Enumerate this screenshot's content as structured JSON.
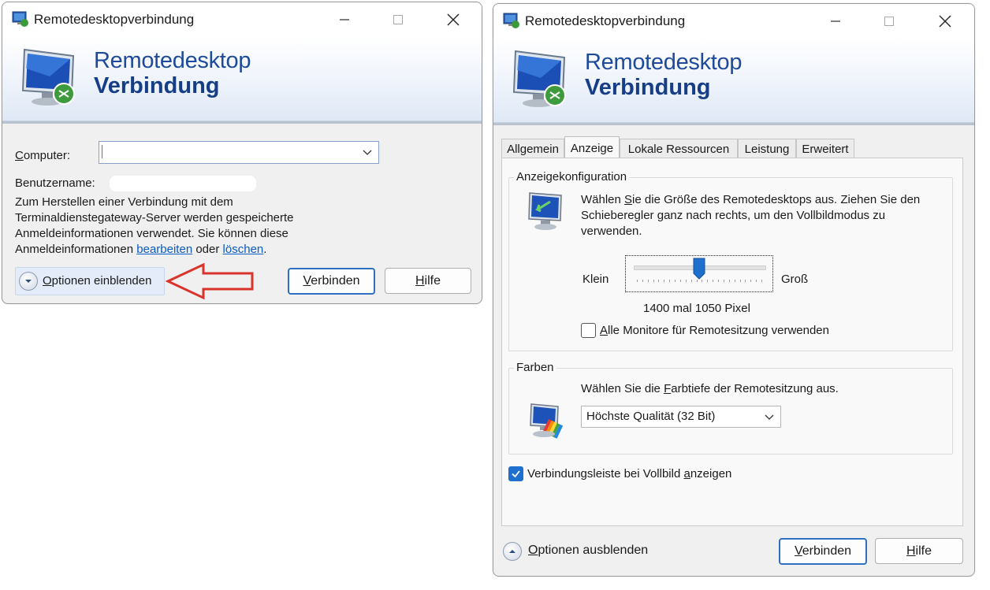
{
  "left": {
    "title": "Remotedesktopverbindung",
    "banner_line1": "Remotedesktop",
    "banner_line2": "Verbindung",
    "computer_label_u": "C",
    "computer_label_rest": "omputer:",
    "username_label": "Benutzername:",
    "info_text": "Zum Herstellen einer Verbindung mit dem Terminaldienstegateway-Server werden gespeicherte Anmeldeinformationen verwendet. Sie können diese Anmeldeinformationen",
    "link_edit": "bearbeiten",
    "word_or": "oder",
    "link_delete": "löschen",
    "period": ".",
    "options_u": "O",
    "options_rest": "ptionen einblenden",
    "connect_u": "V",
    "connect_rest": "erbinden",
    "help_u": "H",
    "help_rest": "ilfe"
  },
  "right": {
    "title": "Remotedesktopverbindung",
    "banner_line1": "Remotedesktop",
    "banner_line2": "Verbindung",
    "tabs": [
      "Allgemein",
      "Anzeige",
      "Lokale Ressourcen",
      "Leistung",
      "Erweitert"
    ],
    "active_tab": "Anzeige",
    "group1_title": "Anzeigekonfiguration",
    "g1_text_a": "Wählen ",
    "g1_text_u": "S",
    "g1_text_b": "ie die Größe des Remotedesktops aus. Ziehen Sie den Schieberegler ganz nach rechts, um den Vollbildmodus zu verwenden.",
    "slider_min": "Klein",
    "slider_max": "Groß",
    "slider_position": 0.5,
    "resolution_text": "1400 mal 1050 Pixel",
    "monitors_u": "A",
    "monitors_rest": "lle Monitore für Remotesitzung verwenden",
    "monitors_checked": false,
    "group2_title": "Farben",
    "g2_text_a": "Wählen Sie die ",
    "g2_text_u": "F",
    "g2_text_b": "arbtiefe der Remotesitzung aus.",
    "color_depth": "Höchste Qualität (32 Bit)",
    "bar_a": "Verbindungsleiste bei Vollbild ",
    "bar_u": "a",
    "bar_b": "nzeigen",
    "bar_checked": true,
    "options_u": "O",
    "options_rest": "ptionen ausblenden",
    "connect_u": "V",
    "connect_rest": "erbinden",
    "help_u": "H",
    "help_rest": "ilfe"
  },
  "colors": {
    "accent": "#1e6fce",
    "banner_text": "#1e4b99",
    "link": "#0a5bc4",
    "arrow": "#d9342b"
  }
}
